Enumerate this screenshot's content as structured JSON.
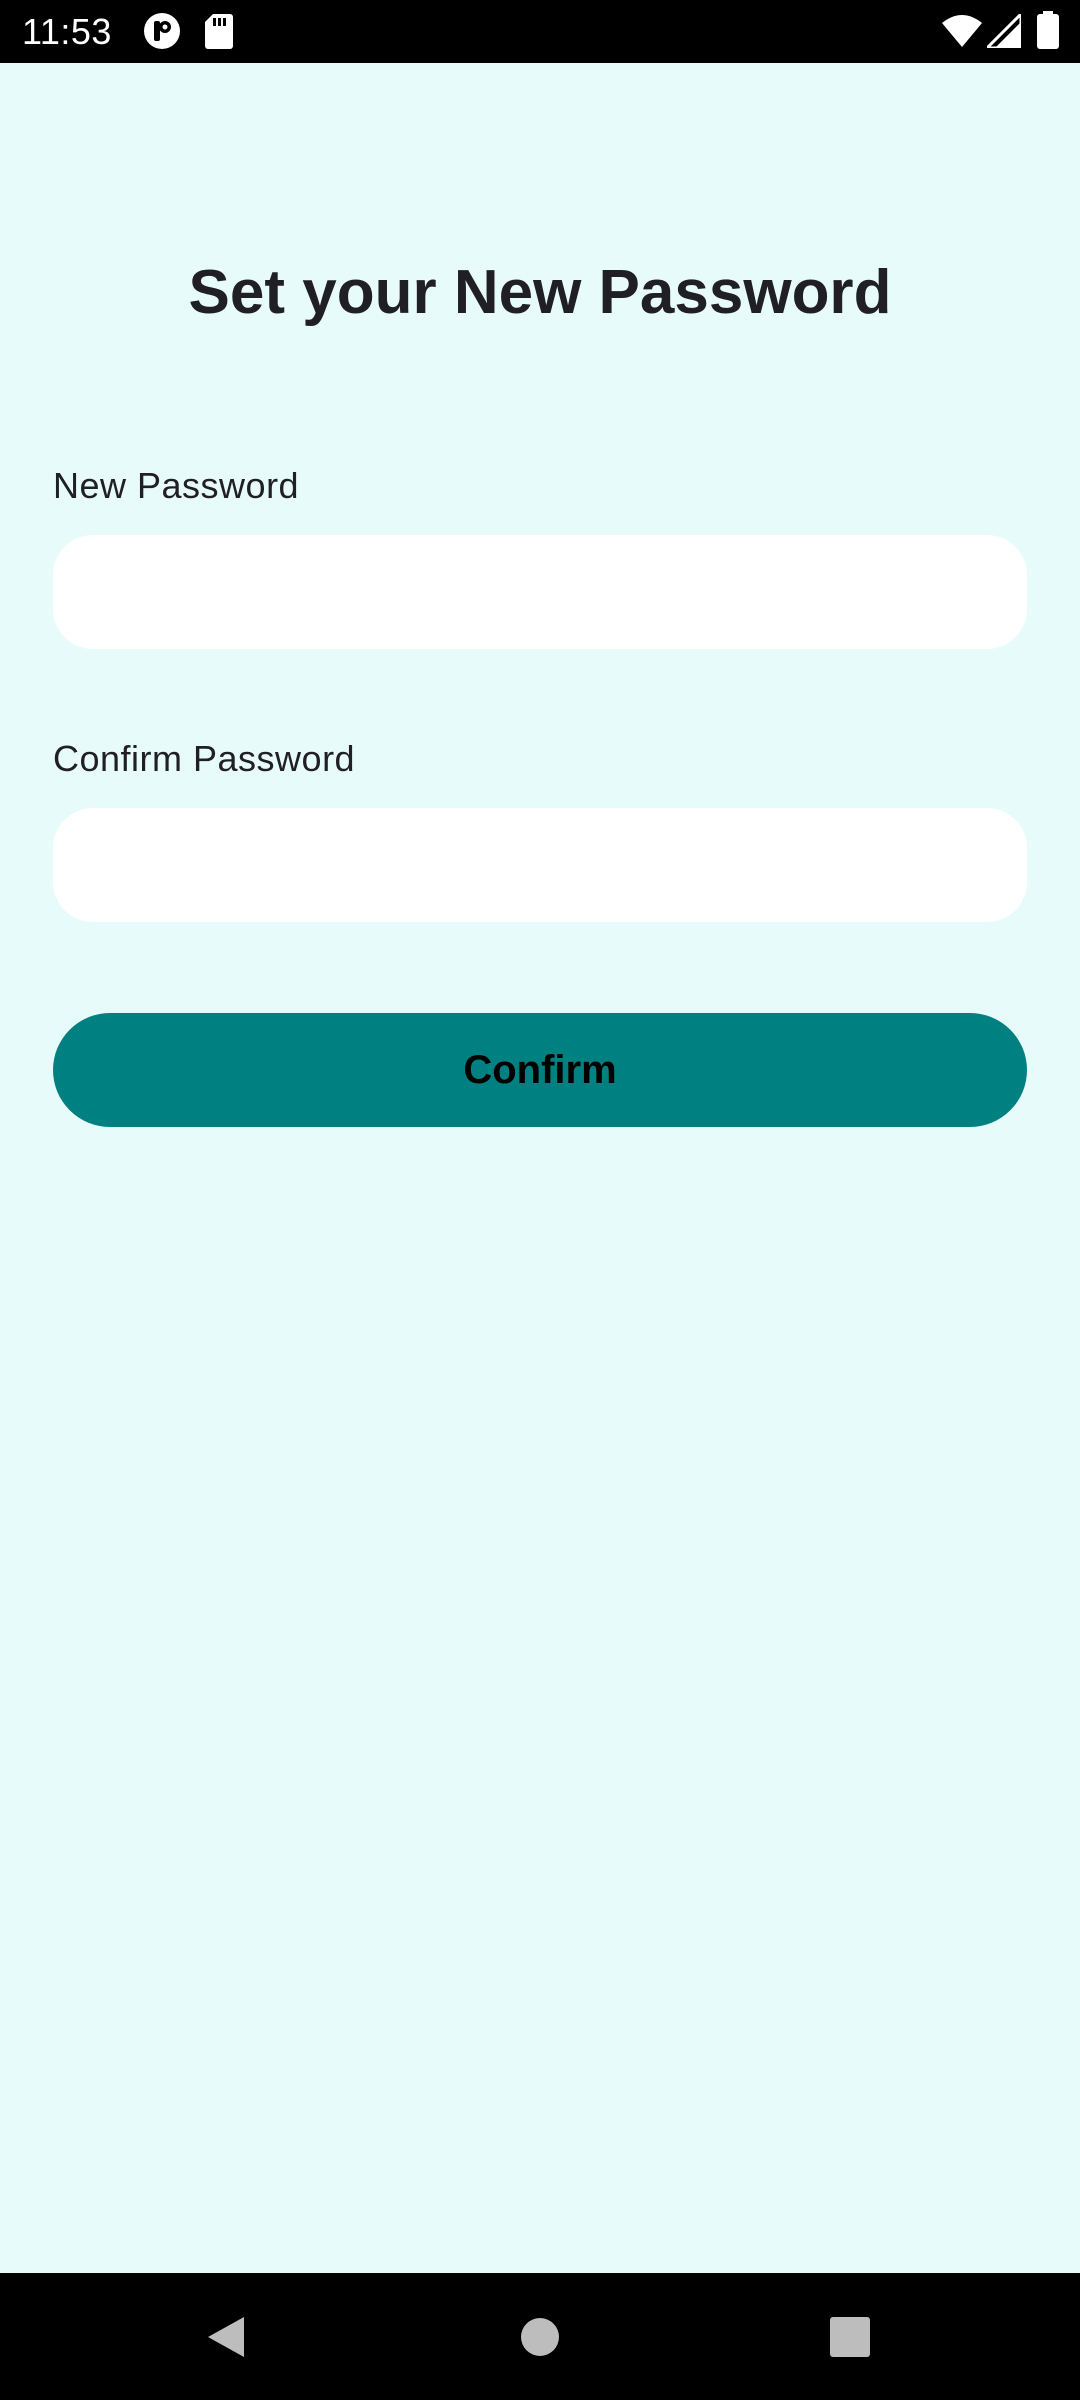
{
  "status_bar": {
    "time": "11:53",
    "icons": [
      "app-notification-icon",
      "sd-card-icon",
      "wifi-icon",
      "cellular-signal-icon",
      "battery-icon"
    ]
  },
  "page": {
    "title": "Set your New Password"
  },
  "form": {
    "new_password": {
      "label": "New Password",
      "value": "",
      "placeholder": ""
    },
    "confirm_password": {
      "label": "Confirm Password",
      "value": "",
      "placeholder": ""
    },
    "confirm_button_label": "Confirm"
  },
  "nav_bar": {
    "buttons": [
      "back-icon",
      "home-icon",
      "recents-icon"
    ]
  },
  "colors": {
    "background": "#e8fbfb",
    "accent": "#008080",
    "input_background": "#ffffff",
    "text": "#1f1f24",
    "system_bars": "#000000"
  }
}
